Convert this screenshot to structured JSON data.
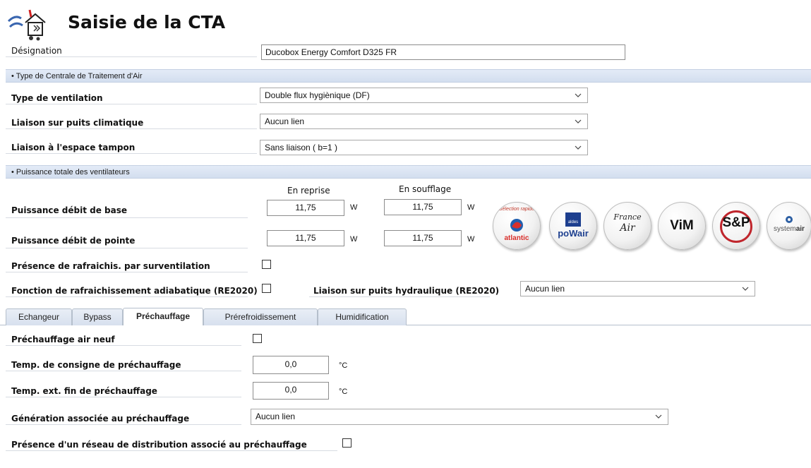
{
  "window": {
    "title": "Saisie de la CTA"
  },
  "designation": {
    "label": "Désignation",
    "value": "Ducobox Energy Comfort D325 FR"
  },
  "sections": {
    "cta_type": "• Type de Centrale de Traitement d'Air",
    "puissance": "• Puissance totale des ventilateurs"
  },
  "ventilation": {
    "type": {
      "label": "Type de ventilation",
      "value": "Double flux hygiènique (DF)"
    },
    "puits_climatique": {
      "label": "Liaison sur puits climatique",
      "value": "Aucun lien"
    },
    "espace_tampon": {
      "label": "Liaison à l'espace tampon",
      "value": "Sans liaison ( b=1 )"
    }
  },
  "puissance": {
    "col_reprise": "En reprise",
    "col_soufflage": "En soufflage",
    "unit": "W",
    "base": {
      "label": "Puissance débit de base",
      "reprise": "11,75",
      "soufflage": "11,75"
    },
    "pointe": {
      "label": "Puissance débit de pointe",
      "reprise": "11,75",
      "soufflage": "11,75"
    }
  },
  "options": {
    "rafraichis": {
      "label": "Présence de rafraichis. par surventilation",
      "checked": false
    },
    "adiabatique": {
      "label": "Fonction de rafraichissement adiabatique (RE2020)",
      "checked": false
    },
    "puits_hydraulique": {
      "label": "Liaison sur puits hydraulique (RE2020)",
      "value": "Aucun lien"
    }
  },
  "logos": {
    "atlantic": {
      "arc": "Sélection rapide",
      "name": "atlantic"
    },
    "aldes": {
      "top": "aldes",
      "name": "poWair"
    },
    "france_air": {
      "line1": "France",
      "line2": "Air"
    },
    "vim": {
      "name": "ViM"
    },
    "sp": {
      "name": "S&P"
    },
    "systemair": {
      "name1": "system",
      "name2": "air"
    }
  },
  "tabs": [
    {
      "label": "Echangeur",
      "active": false
    },
    {
      "label": "Bypass",
      "active": false
    },
    {
      "label": "Préchauffage",
      "active": true
    },
    {
      "label": "Prérefroidissement",
      "active": false
    },
    {
      "label": "Humidification",
      "active": false
    }
  ],
  "prechauffage": {
    "air_neuf": {
      "label": "Préchauffage air neuf",
      "checked": false
    },
    "consigne": {
      "label": "Temp. de consigne de préchauffage",
      "value": "0,0",
      "unit": "°C"
    },
    "fin": {
      "label": "Temp. ext. fin de préchauffage",
      "value": "0,0",
      "unit": "°C"
    },
    "generation": {
      "label": "Génération associée au préchauffage",
      "value": "Aucun lien"
    },
    "reseau": {
      "label": "Présence d'un réseau de distribution associé au préchauffage",
      "checked": false
    }
  },
  "colors": {
    "section_bg": "#d8e2f1",
    "border": "#8c8c8c",
    "logo_bg": "#f0f0f0"
  },
  "icons": {
    "app": "house-ventilation-icon",
    "dropdown": "chevron-down-icon"
  }
}
